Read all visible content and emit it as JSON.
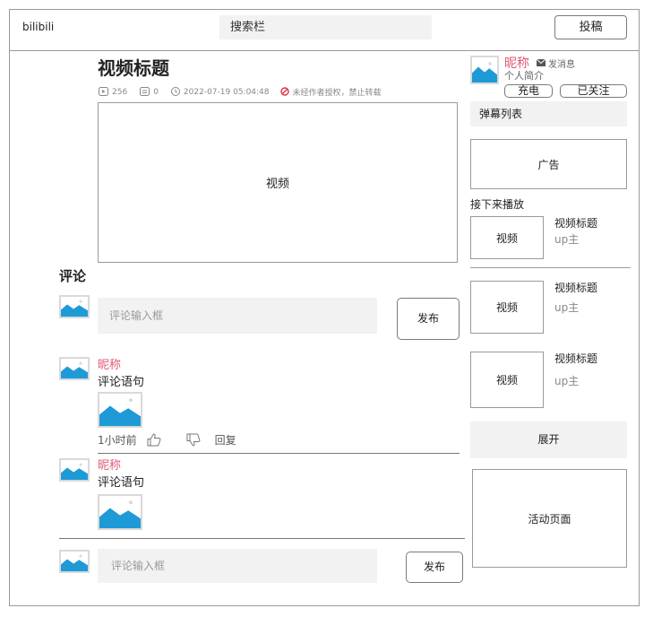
{
  "header": {
    "logo": "bilibili",
    "search_placeholder": "搜索栏",
    "upload_label": "投稿"
  },
  "video": {
    "title": "视频标题",
    "views": "256",
    "danmaku_count": "0",
    "datetime": "2022-07-19 05:04:48",
    "copyright_notice": "未经作者授权，禁止转载",
    "player_label": "视频"
  },
  "comments": {
    "heading": "评论",
    "input_placeholder": "评论输入框",
    "publish_label": "发布",
    "items": [
      {
        "nickname": "昵称",
        "text": "评论语句",
        "time": "1小时前",
        "reply_label": "回复"
      },
      {
        "nickname": "昵称",
        "text": "评论语句"
      }
    ],
    "bottom_input_placeholder": "评论输入框",
    "bottom_publish_label": "发布"
  },
  "uploader": {
    "nickname": "昵称",
    "message_label": "发消息",
    "bio": "个人简介",
    "charge_label": "充电",
    "follow_label": "已关注"
  },
  "sidebar": {
    "danmaku_list_label": "弹幕列表",
    "ad_label": "广告",
    "up_next_label": "接下来播放",
    "next_videos": [
      {
        "thumb_label": "视频",
        "title": "视频标题",
        "uploader": "up主"
      },
      {
        "thumb_label": "视频",
        "title": "视频标题",
        "uploader": "up主"
      },
      {
        "thumb_label": "视频",
        "title": "视频标题",
        "uploader": "up主"
      }
    ],
    "expand_label": "展开",
    "activity_label": "活动页面"
  },
  "colors": {
    "accent_pink": "#e05a77",
    "image_blue": "#1e9ad6",
    "border_gray": "#9a9a9a",
    "fill_gray": "#f2f2f2"
  }
}
